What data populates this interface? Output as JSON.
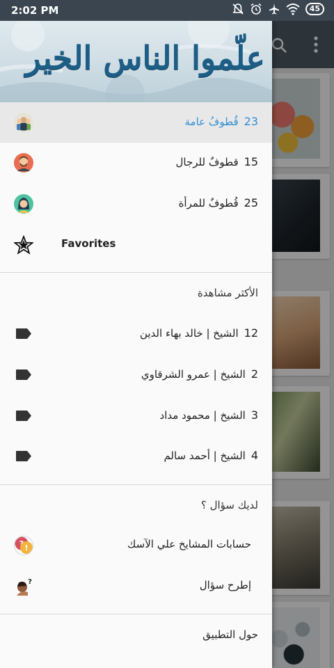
{
  "status_bar": {
    "time": "2:02 PM",
    "battery": "45",
    "icons": [
      "mute-icon",
      "alarm-icon",
      "airplane-icon",
      "wifi-icon"
    ]
  },
  "app_bar": {
    "actions": [
      "search-icon",
      "more-vert-icon"
    ]
  },
  "drawer": {
    "banner_text": "علّموا الناس الخير",
    "categories": [
      {
        "count": "23",
        "label": "قُطوفُ عامة",
        "icon": "group-avatar-icon",
        "active": true
      },
      {
        "count": "15",
        "label": "قطوفٌ للرجال",
        "icon": "man-avatar-icon",
        "active": false
      },
      {
        "count": "25",
        "label": "قُطوفٌ للمرأة",
        "icon": "woman-avatar-icon",
        "active": false
      }
    ],
    "favorites_label": "Favorites",
    "most_viewed": {
      "title": "الأكثر مشاهدة",
      "items": [
        {
          "count": "12",
          "label": "الشيخ | خالد بهاء الدين"
        },
        {
          "count": "2",
          "label": "الشيخ | عمرو الشرقاوي"
        },
        {
          "count": "3",
          "label": "الشيخ | محمود مداد"
        },
        {
          "count": "4",
          "label": "الشيخ | أحمد سالم"
        }
      ]
    },
    "questions": {
      "title": "لديك سؤال ؟",
      "items": [
        {
          "label": "حسابات المشايخ علي الآسك",
          "icon": "question-bubbles-icon"
        },
        {
          "label": "إطرح سؤال",
          "icon": "thinking-person-icon"
        }
      ]
    },
    "about": "حول التطبيق"
  },
  "colors": {
    "status_bar": "#3b4550",
    "app_bar": "#4f5a63",
    "accent": "#2f8fd3",
    "banner_text": "#1d5e86"
  }
}
